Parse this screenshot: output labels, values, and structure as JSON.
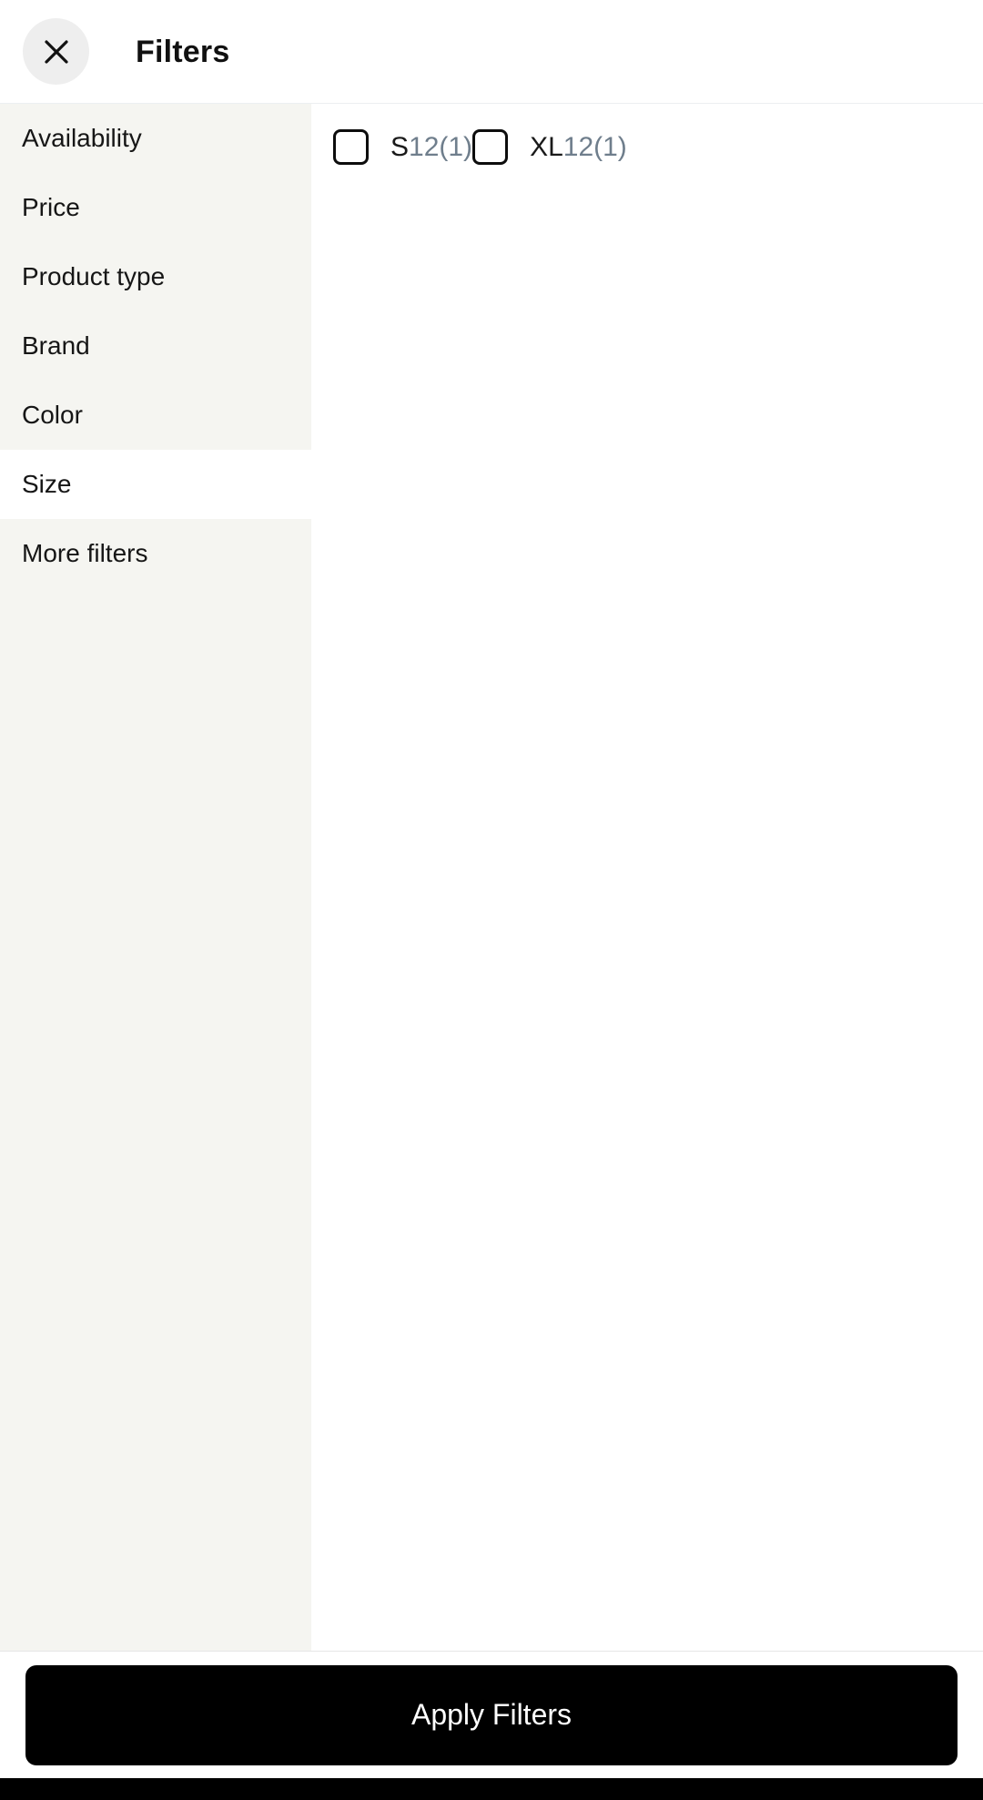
{
  "header": {
    "title": "Filters",
    "close_icon": "close-icon"
  },
  "sidebar": {
    "items": [
      {
        "label": "Availability",
        "selected": false
      },
      {
        "label": "Price",
        "selected": false
      },
      {
        "label": "Product type",
        "selected": false
      },
      {
        "label": "Brand",
        "selected": false
      },
      {
        "label": "Color",
        "selected": false
      },
      {
        "label": "Size",
        "selected": true
      },
      {
        "label": "More filters",
        "selected": false
      }
    ]
  },
  "content": {
    "active_group": "Size",
    "options": [
      {
        "label": "S",
        "count": "12(1)",
        "checked": false
      },
      {
        "label": "XL",
        "count": "12(1)",
        "checked": false
      }
    ]
  },
  "footer": {
    "apply_label": "Apply Filters"
  },
  "colors": {
    "sidebar_bg": "#f5f5f1",
    "selected_bg": "#ffffff",
    "close_btn_bg": "#eeeeee",
    "count_text": "#6f7e8c",
    "apply_bg": "#000000",
    "apply_text": "#ffffff",
    "navbar": "#000000"
  }
}
